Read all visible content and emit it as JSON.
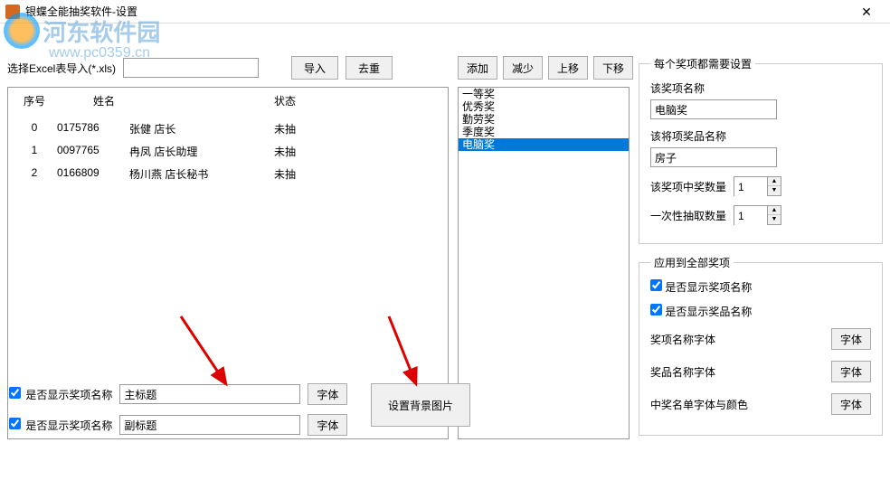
{
  "window": {
    "title": "银蝶全能抽奖软件-设置"
  },
  "watermark": {
    "text1": "河东软件园",
    "text2": "www.pc0359.cn"
  },
  "excel": {
    "label": "选择Excel表导入(*.xls)",
    "value": "",
    "import_btn": "导入",
    "dedup_btn": "去重"
  },
  "table": {
    "headers": {
      "no": "序号",
      "name": "姓名",
      "status": "状态"
    },
    "rows": [
      {
        "no": "0",
        "id": "0175786",
        "name": "张健    店长",
        "status": "未抽"
      },
      {
        "no": "1",
        "id": "0097765",
        "name": "冉凤    店长助理",
        "status": "未抽"
      },
      {
        "no": "2",
        "id": "0166809",
        "name": "杨川燕   店长秘书",
        "status": "未抽"
      }
    ]
  },
  "mid_buttons": {
    "add": "添加",
    "remove": "减少",
    "up": "上移",
    "down": "下移"
  },
  "prize_list": {
    "items": [
      "一等奖",
      "优秀奖",
      "勤劳奖",
      "季度奖",
      "电脑奖"
    ],
    "selected": 4
  },
  "bottom": {
    "cb1_label": "是否显示奖项名称",
    "title_value": "主标题",
    "font_btn": "字体",
    "cb2_label": "是否显示奖项名称",
    "subtitle_value": "副标题",
    "bg_btn": "设置背景图片"
  },
  "settings1": {
    "legend": "每个奖项都需要设置",
    "prize_name_label": "该奖项名称",
    "prize_name_value": "电脑奖",
    "product_name_label": "该将项奖品名称",
    "product_name_value": "房子",
    "win_count_label": "该奖项中奖数量",
    "win_count_value": "1",
    "once_count_label": "一次性抽取数量",
    "once_count_value": "1"
  },
  "settings2": {
    "legend": "应用到全部奖项",
    "cb1": "是否显示奖项名称",
    "cb2": "是否显示奖品名称",
    "font1_label": "奖项名称字体",
    "font2_label": "奖品名称字体",
    "font3_label": "中奖名单字体与颜色",
    "font_btn": "字体"
  }
}
